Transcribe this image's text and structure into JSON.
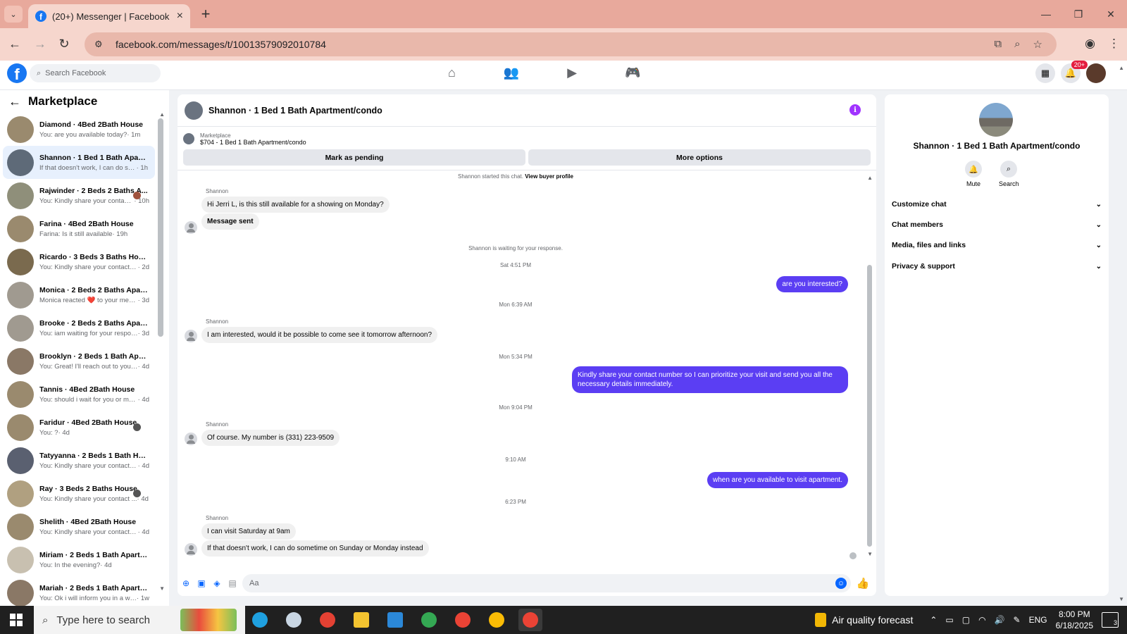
{
  "browser": {
    "tab_title": "(20+) Messenger | Facebook",
    "url": "facebook.com/messages/t/10013579092010784"
  },
  "fb": {
    "search_placeholder": "Search Facebook",
    "notif_badge": "20+"
  },
  "sidebar": {
    "title": "Marketplace",
    "conversations": [
      {
        "name": "Diamond · 4Bed 2Bath House",
        "preview": "You: are you available today?",
        "time": "· 1m",
        "color": "#9a8a6e"
      },
      {
        "name": "Shannon · 1 Bed 1 Bath Apartm...",
        "preview": "If that doesn't work, I can do som...",
        "time": "· 1h",
        "color": "#5e6a78"
      },
      {
        "name": "Rajwinder · 2 Beds 2 Baths A...",
        "preview": "You: Kindly share your contact...",
        "time": "· 10h",
        "color": "#8f8f7a"
      },
      {
        "name": "Farina · 4Bed 2Bath House",
        "preview": "Farina: Is it still available",
        "time": "· 19h",
        "color": "#9a8a6e"
      },
      {
        "name": "Ricardo · 3 Beds 3 Baths House",
        "preview": "You: Kindly share your contact nu...",
        "time": "· 2d",
        "color": "#7a6a4e"
      },
      {
        "name": "Monica · 2 Beds 2 Baths Apart...",
        "preview": "Monica reacted ❤️ to your messa...",
        "time": "· 3d",
        "color": "#a09a90"
      },
      {
        "name": "Brooke · 2 Beds 2 Baths Apart...",
        "preview": "You: iam waiting for your response.",
        "time": "· 3d",
        "color": "#a09a90"
      },
      {
        "name": "Brooklyn · 2 Beds 1 Bath Apart...",
        "preview": "You: Great! I'll reach out to you sh...",
        "time": "· 4d",
        "color": "#8a7866"
      },
      {
        "name": "Tannis · 4Bed 2Bath House",
        "preview": "You: should i wait for you or mov...",
        "time": "· 4d",
        "color": "#9a8a6e"
      },
      {
        "name": "Faridur · 4Bed 2Bath House",
        "preview": "You: ?",
        "time": "· 4d",
        "color": "#9a8a6e"
      },
      {
        "name": "Tatyyanna · 2 Beds 1 Bath House",
        "preview": "You: Kindly share your contact nu...",
        "time": "· 4d",
        "color": "#5a6070"
      },
      {
        "name": "Ray · 3 Beds 2 Baths House",
        "preview": "You: Kindly share your contact ...",
        "time": "· 4d",
        "color": "#b0a080"
      },
      {
        "name": "Shelith · 4Bed 2Bath House",
        "preview": "You: Kindly share your contact nu...",
        "time": "· 4d",
        "color": "#9a8a6e"
      },
      {
        "name": "Miriam · 2 Beds 1 Bath Apartm...",
        "preview": "You: In the evening?",
        "time": "· 4d",
        "color": "#c8c0b0"
      },
      {
        "name": "Mariah · 2 Beds 1 Bath Apartm...",
        "preview": "You: Ok i will inform you in a while",
        "time": "· 1w",
        "color": "#8a7866"
      }
    ]
  },
  "chat": {
    "title": "Shannon · 1 Bed 1 Bath Apartment/condo",
    "marketplace_label": "Marketplace",
    "item": "$704 - 1 Bed 1 Bath Apartment/condo",
    "mark_pending": "Mark as pending",
    "more_options": "More options",
    "started": "Shannon started this chat.",
    "view_profile": "View buyer profile",
    "sender": "Shannon",
    "msg1": "Hi Jerri L, is this still available for a showing on Monday?",
    "msg_sent": "Message sent",
    "waiting": "Shannon is waiting for your response.",
    "ts1": "Sat 4:51 PM",
    "out1": "are you interested?",
    "ts2": "Mon 6:39 AM",
    "msg2": "I am interested, would it be possible to come see it tomorrow afternoon?",
    "ts3": "Mon 5:34 PM",
    "out2": "Kindly share your contact number so I can prioritize your visit and send you all the necessary details immediately.",
    "ts4": "Mon 9:04 PM",
    "msg3": "Of course. My number is (331) 223-9509",
    "ts5": "9:10 AM",
    "out3": "when are you available to visit apartment.",
    "ts6": "6:23 PM",
    "msg4": "I can visit Saturday at 9am",
    "msg5": "If that doesn't work, I can do sometime on Sunday or Monday instead",
    "composer_placeholder": "Aa"
  },
  "info_panel": {
    "name": "Shannon · 1 Bed 1 Bath Apartment/condo",
    "mute": "Mute",
    "search": "Search",
    "sections": [
      "Customize chat",
      "Chat members",
      "Media, files and links",
      "Privacy & support"
    ]
  },
  "taskbar": {
    "search_placeholder": "Type here to search",
    "weather": "Air quality forecast",
    "lang": "ENG",
    "time": "8:00 PM",
    "date": "6/18/2025",
    "notif_count": "3"
  },
  "colors": {
    "accent": "#5b3ef3",
    "fb_blue": "#1877f2"
  }
}
